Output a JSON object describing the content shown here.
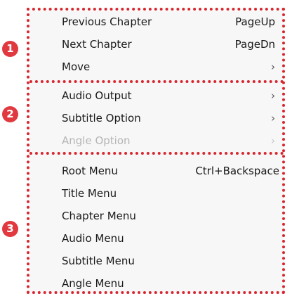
{
  "menu": {
    "groups": [
      {
        "badge": "1",
        "items": [
          {
            "label": "Previous Chapter",
            "shortcut": "PageUp",
            "submenu": false,
            "disabled": false
          },
          {
            "label": "Next Chapter",
            "shortcut": "PageDn",
            "submenu": false,
            "disabled": false
          },
          {
            "label": "Move",
            "shortcut": "",
            "submenu": true,
            "disabled": false
          }
        ]
      },
      {
        "badge": "2",
        "items": [
          {
            "label": "Audio Output",
            "shortcut": "",
            "submenu": true,
            "disabled": false
          },
          {
            "label": "Subtitle Option",
            "shortcut": "",
            "submenu": true,
            "disabled": false
          },
          {
            "label": "Angle Option",
            "shortcut": "",
            "submenu": true,
            "disabled": true
          }
        ]
      },
      {
        "badge": "3",
        "items": [
          {
            "label": "Root Menu",
            "shortcut": "Ctrl+Backspace",
            "submenu": false,
            "disabled": false
          },
          {
            "label": "Title Menu",
            "shortcut": "",
            "submenu": false,
            "disabled": false
          },
          {
            "label": "Chapter Menu",
            "shortcut": "",
            "submenu": false,
            "disabled": false
          },
          {
            "label": "Audio Menu",
            "shortcut": "",
            "submenu": false,
            "disabled": false
          },
          {
            "label": "Subtitle Menu",
            "shortcut": "",
            "submenu": false,
            "disabled": false
          },
          {
            "label": "Angle Menu",
            "shortcut": "",
            "submenu": false,
            "disabled": false
          }
        ]
      }
    ],
    "submenu_glyph": "›"
  },
  "colors": {
    "annotation_red": "#d8262f",
    "badge_red": "#e0393f",
    "disabled_text": "#b5b5b5",
    "menu_background": "#f7f7f7"
  }
}
